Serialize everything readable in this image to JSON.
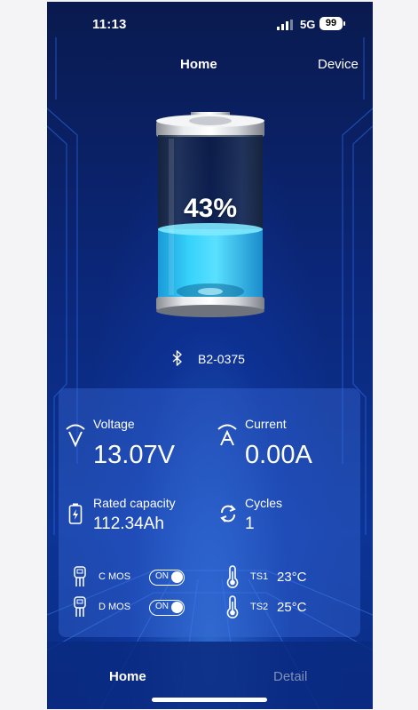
{
  "status_bar": {
    "time": "11:13",
    "network": "5G",
    "battery": "99"
  },
  "top_tabs": {
    "home": "Home",
    "device": "Device"
  },
  "battery": {
    "percent_label": "43%",
    "level": 0.43
  },
  "device": {
    "name": "B2-0375",
    "icon": "bluetooth-icon"
  },
  "metrics": {
    "voltage": {
      "label": "Voltage",
      "value": "13.07V",
      "icon": "voltage-icon"
    },
    "current": {
      "label": "Current",
      "value": "0.00A",
      "icon": "current-icon"
    },
    "rated_capacity": {
      "label": "Rated capacity",
      "value": "112.34Ah",
      "icon": "battery-charge-icon"
    },
    "cycles": {
      "label": "Cycles",
      "value": "1",
      "icon": "cycle-icon"
    }
  },
  "mos": {
    "c": {
      "label": "C MOS",
      "state": "ON",
      "icon": "transistor-icon"
    },
    "d": {
      "label": "D MOS",
      "state": "ON",
      "icon": "transistor-icon"
    }
  },
  "temps": {
    "ts1": {
      "label": "TS1",
      "value": "23°C",
      "icon": "thermometer-icon"
    },
    "ts2": {
      "label": "TS2",
      "value": "25°C",
      "icon": "thermometer-icon"
    }
  },
  "bottom_tabs": {
    "home": "Home",
    "detail": "Detail"
  },
  "colors": {
    "background": "#0b2779",
    "liquid": "#29c8f4",
    "panel": "#3c6edc"
  }
}
